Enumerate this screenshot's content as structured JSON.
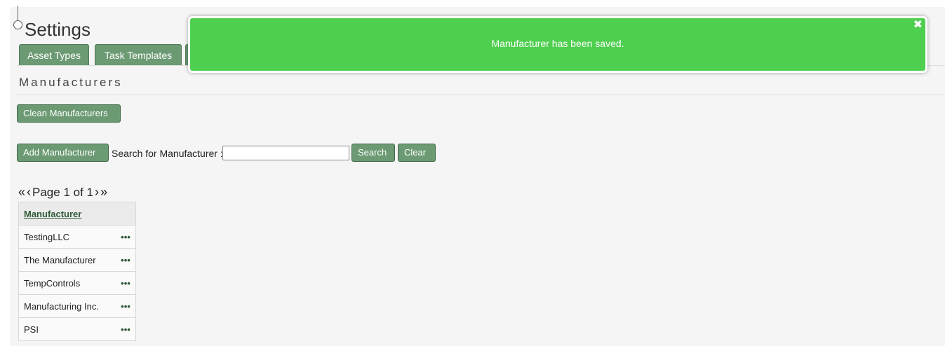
{
  "page": {
    "title": "Settings"
  },
  "tabs": [
    {
      "label": "Asset Types"
    },
    {
      "label": "Task Templates"
    },
    {
      "label": ""
    }
  ],
  "section": {
    "title": "Manufacturers"
  },
  "buttons": {
    "clean": "Clean Manufacturers",
    "add": "Add Manufacturer",
    "search": "Search",
    "clear": "Clear"
  },
  "search": {
    "label": "Search for Manufacturer :",
    "value": "",
    "placeholder": ""
  },
  "pager": {
    "first_icon": "«",
    "prev_icon": "‹",
    "text": "Page 1 of 1",
    "next_icon": "›",
    "last_icon": "»"
  },
  "table": {
    "header": "Manufacturer",
    "action_icon": "•••",
    "rows": [
      {
        "name": "TestingLLC"
      },
      {
        "name": "The Manufacturer"
      },
      {
        "name": "TempControls"
      },
      {
        "name": "Manufacturing Inc."
      },
      {
        "name": "PSI"
      }
    ]
  },
  "toast": {
    "message": "Manufacturer has been saved.",
    "close_icon": "✖",
    "color": "#4fcf4f"
  },
  "colors": {
    "accent": "#6b9a73"
  }
}
